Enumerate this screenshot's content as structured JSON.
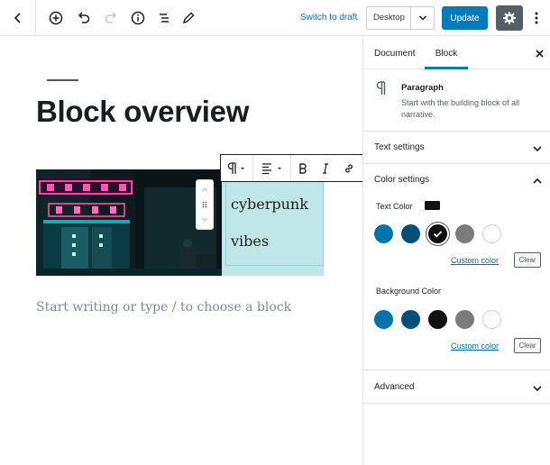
{
  "topbar": {
    "switch_draft": "Switch to draft",
    "preview_device": "Desktop",
    "update_label": "Update"
  },
  "editor": {
    "title": "Block overview",
    "media_text_lines": [
      "cyberpunk",
      "vibes"
    ],
    "placeholder": "Start writing or type / to choose a block"
  },
  "sidebar": {
    "tabs": [
      {
        "label": "Document",
        "active": false
      },
      {
        "label": "Block",
        "active": true
      }
    ],
    "block_card": {
      "title": "Paragraph",
      "description": "Start with the building block of all narrative."
    },
    "panels": {
      "text_settings": "Text settings",
      "color_settings": "Color settings",
      "advanced": "Advanced"
    },
    "text_color": {
      "label": "Text Color",
      "selected_color": "#111111",
      "swatches": [
        "#0073aa",
        "#00507a",
        "#111111",
        "#7b7b7b",
        "#ffffff"
      ],
      "selected_index": 2,
      "custom_link": "Custom color",
      "clear_label": "Clear"
    },
    "background_color": {
      "label": "Background Color",
      "swatches": [
        "#0073aa",
        "#00507a",
        "#111111",
        "#7b7b7b",
        "#ffffff"
      ],
      "custom_link": "Custom color",
      "clear_label": "Clear"
    }
  },
  "colors": {
    "accent": "#007cba",
    "media_text_bg": "#bfe6e8"
  }
}
